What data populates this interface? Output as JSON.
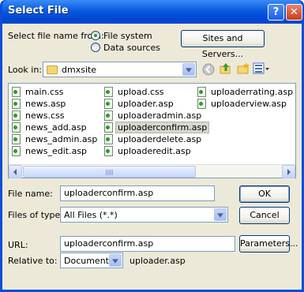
{
  "window": {
    "title": "Select File",
    "help_label": "?",
    "close_label": "✕"
  },
  "select_from": {
    "label": "Select file name from:",
    "options": [
      "File system",
      "Data sources"
    ],
    "selected": "File system",
    "sites_button": "Sites and Servers..."
  },
  "look_in": {
    "label": "Look in:",
    "value": "dmxsite",
    "tools": [
      "back-icon",
      "up-folder-icon",
      "new-folder-icon",
      "view-menu-icon"
    ]
  },
  "files": {
    "columns": [
      [
        "main.css",
        "news.asp",
        "news.css",
        "news_add.asp",
        "news_admin.asp",
        "news_edit.asp"
      ],
      [
        "upload.css",
        "uploader.asp",
        "uploaderadmin.asp",
        "uploaderconfirm.asp",
        "uploaderdelete.asp",
        "uploaderedit.asp"
      ],
      [
        "uploaderrating.asp",
        "uploaderview.asp"
      ]
    ],
    "selected": "uploaderconfirm.asp"
  },
  "file_name": {
    "label": "File name:",
    "value": "uploaderconfirm.asp",
    "ok_button": "OK"
  },
  "file_type": {
    "label": "Files of type:",
    "value": "All Files (*.*)",
    "cancel_button": "Cancel"
  },
  "url": {
    "label": "URL:",
    "value": "uploaderconfirm.asp",
    "parameters_button": "Parameters..."
  },
  "relative": {
    "label": "Relative to:",
    "value": "Document",
    "path": "uploader.asp"
  },
  "colors": {
    "titlebar": "#0a4ed8",
    "dialog_bg": "#ece9d8",
    "radio_dot": "#21a121"
  }
}
